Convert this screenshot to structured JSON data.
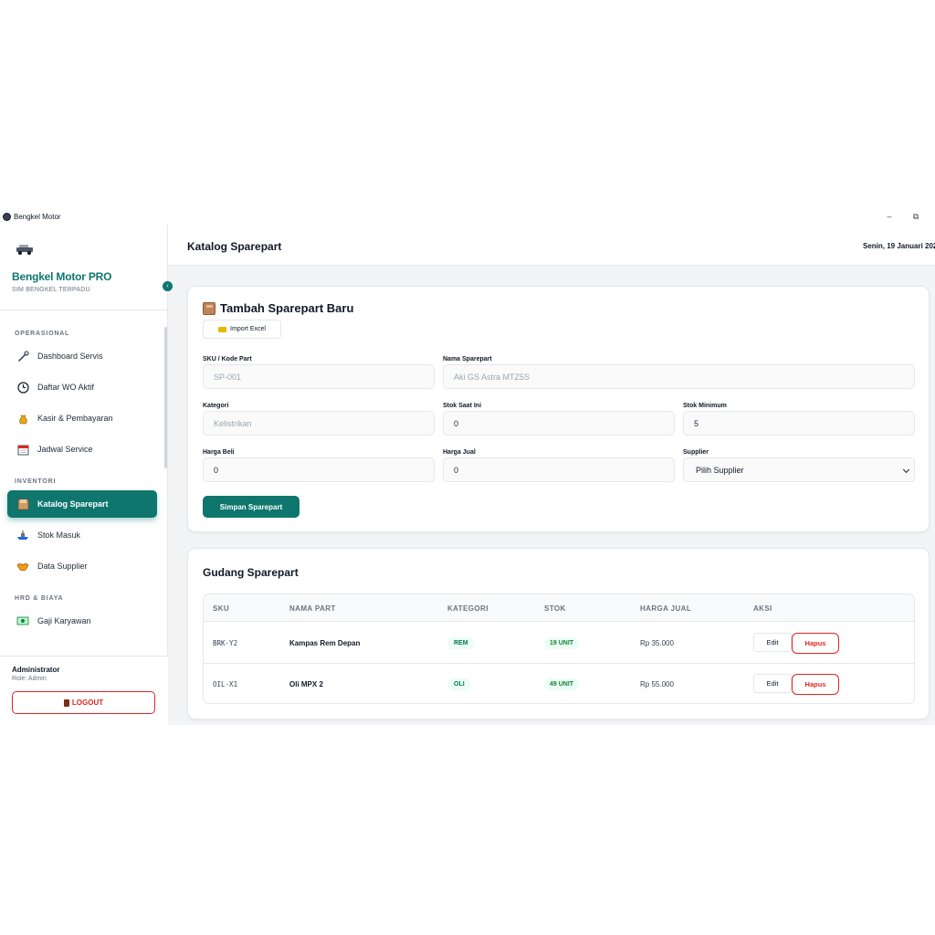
{
  "window": {
    "title": "Bengkel Motor",
    "min_glyph": "–",
    "max_glyph": "⧉"
  },
  "sidebar": {
    "brand": "Bengkel Motor PRO",
    "subtitle": "SIM BENGKEL TERPADU",
    "collapse_glyph": "‹",
    "sections": [
      {
        "label": "OPERASIONAL"
      },
      {
        "label": "INVENTORI"
      },
      {
        "label": "HRD & BIAYA"
      }
    ],
    "items": [
      {
        "label": "Dashboard Servis",
        "icon": "wrench-icon"
      },
      {
        "label": "Daftar WO Aktif",
        "icon": "clock-icon"
      },
      {
        "label": "Kasir & Pembayaran",
        "icon": "money-bag-icon"
      },
      {
        "label": "Jadwal Service",
        "icon": "calendar-icon"
      },
      {
        "label": "Katalog Sparepart",
        "icon": "package-icon",
        "active": true
      },
      {
        "label": "Stok Masuk",
        "icon": "ship-icon"
      },
      {
        "label": "Data Supplier",
        "icon": "handshake-icon"
      },
      {
        "label": "Gaji Karyawan",
        "icon": "banknote-icon"
      }
    ],
    "user": {
      "name": "Administrator",
      "role": "Role: Admin"
    },
    "logout_label": "LOGOUT"
  },
  "header": {
    "title": "Katalog Sparepart",
    "date": "Senin, 19 Januari 202"
  },
  "form": {
    "title": "Tambah Sparepart Baru",
    "import_label": "Import Excel",
    "fields": {
      "sku": {
        "label": "SKU / Kode Part",
        "placeholder": "SP-001",
        "value": ""
      },
      "nama": {
        "label": "Nama Sparepart",
        "placeholder": "Aki GS Astra MTZ5S",
        "value": ""
      },
      "kategori": {
        "label": "Kategori",
        "placeholder": "Kelistrikan",
        "value": ""
      },
      "stok": {
        "label": "Stok Saat Ini",
        "value": "0"
      },
      "stok_min": {
        "label": "Stok Minimum",
        "value": "5"
      },
      "harga_beli": {
        "label": "Harga Beli",
        "value": "0"
      },
      "harga_jual": {
        "label": "Harga Jual",
        "value": "0"
      },
      "supplier": {
        "label": "Supplier",
        "selected": "Pilih Supplier"
      }
    },
    "save_label": "Simpan Sparepart"
  },
  "table": {
    "title": "Gudang Sparepart",
    "columns": [
      "SKU",
      "NAMA PART",
      "KATEGORI",
      "STOK",
      "HARGA JUAL",
      "AKSI"
    ],
    "rows": [
      {
        "sku": "BRK-Y2",
        "name": "Kampas Rem Depan",
        "category": "REM",
        "stock": "19 UNIT",
        "price": "Rp 35.000"
      },
      {
        "sku": "OIL-X1",
        "name": "Oli MPX 2",
        "category": "OLI",
        "stock": "49 UNIT",
        "price": "Rp 55.000"
      }
    ],
    "edit_label": "Edit",
    "delete_label": "Hapus"
  },
  "colors": {
    "accent": "#0f766e",
    "danger": "#dc2626",
    "badge_bg": "#ecfdf5"
  }
}
